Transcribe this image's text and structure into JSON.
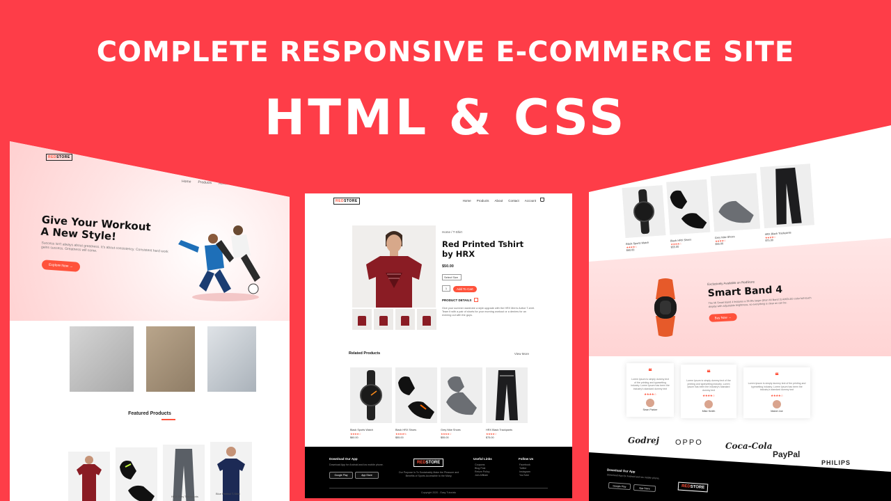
{
  "headline": {
    "line1": "COMPLETE RESPONSIVE E-COMMERCE SITE",
    "line2": "HTML & CSS"
  },
  "brand": {
    "logo_red": "RED",
    "logo_dark": "STORE",
    "accent_color": "#ff523b",
    "background_color": "#fe3d48"
  },
  "nav": {
    "items": [
      "Home",
      "Products",
      "About",
      "Contact",
      "Account"
    ],
    "cart_icon": "cart-icon"
  },
  "left_page": {
    "hero_title_1": "Give Your Workout",
    "hero_title_2": "A New Style!",
    "hero_text": "Success isn't always about greatness. It's about consistency. Consistent hard work gains success. Greatness will come.",
    "hero_button": "Explore Now →",
    "featured_title": "Featured Products",
    "products": [
      "",
      "",
      "HRX Grey Trackpants",
      "Blue Perfect T-Shirt"
    ]
  },
  "product_page": {
    "breadcrumb": "Home / T-Shirt",
    "title": "Red Printed Tshirt by HRX",
    "price": "$50.00",
    "select_size": "Select Size",
    "quantity": "1",
    "add_to_cart": "Add To Cart",
    "details_label": "PRODUCT DETAILS",
    "description": "Give your summer wardrobe a style upgrade with the HRX Men's Active T-shirt. Team it with a pair of shorts for your morning workout or a denims for an evening out with the guys.",
    "related_title": "Related Products",
    "view_more": "View More",
    "related": [
      {
        "name": "Black Sports Watch",
        "stars": "★★★★☆",
        "price": "$60.00"
      },
      {
        "name": "Black HRX Shoes",
        "stars": "★★★★½",
        "price": "$55.00"
      },
      {
        "name": "Grey Nike Shoes",
        "stars": "★★★★☆",
        "price": "$55.00"
      },
      {
        "name": "HRX Black Trackpants",
        "stars": "★★★★☆",
        "price": "$75.00"
      }
    ]
  },
  "footer": {
    "download_title": "Download Our App",
    "download_text": "Download App for Android and ios mobile phone.",
    "google_play": "Google Play",
    "app_store": "App Store",
    "purpose": "Our Purpose Is To Sustainably Make the Pleasure and Benefits of Sports Accessible to the Many.",
    "useful_links_title": "Useful Links",
    "useful_links": [
      "Coupons",
      "Blog Post",
      "Return Policy",
      "Join Affiliate"
    ],
    "follow_title": "Follow Us",
    "follow_links": [
      "Facebook",
      "Twitter",
      "Instagram",
      "YouTube"
    ],
    "copyright": "Copyright 2020 - Easy Tutorials"
  },
  "right_page": {
    "top_products": [
      {
        "name": "Black Sports Watch",
        "stars": "★★★★☆",
        "price": "$60.00"
      },
      {
        "name": "Black HRX Shoes",
        "stars": "★★★★☆",
        "price": "$55.00"
      },
      {
        "name": "Grey Nike Shoes",
        "stars": "★★★★☆",
        "price": "$55.00"
      },
      {
        "name": "HRX Black Trackpants",
        "stars": "★★★★☆",
        "price": "$75.00"
      }
    ],
    "offer_small": "Exclusively Available on RedStore",
    "offer_title": "Smart Band 4",
    "offer_desc": "The Mi Smart Band 4 features a 39.9% larger (than Mi Band 3) AMOLED color full-touch display with adjustable brightness, so everything is clear as can be.",
    "offer_button": "Buy Now →",
    "testimonials": [
      {
        "text": "Lorem Ipsum is simply dummy text of the printing and typesetting industry. Lorem Ipsum has been the industry's standard dummy text",
        "stars": "★★★★☆",
        "name": "Sean Parker"
      },
      {
        "text": "Lorem Ipsum is simply dummy text of the printing and typesetting industry. Lorem Ipsum has been the industry's standard dummy text",
        "stars": "★★★★☆",
        "name": "Mike Smith"
      },
      {
        "text": "Lorem Ipsum is simply dummy text of the printing and typesetting industry. Lorem Ipsum has been the industry's standard dummy text",
        "stars": "★★★★☆",
        "name": "Mabel Joe"
      }
    ],
    "brands": [
      "Godrej",
      "OPPO",
      "Coca-Cola",
      "PayPal",
      "PHILIPS"
    ]
  }
}
